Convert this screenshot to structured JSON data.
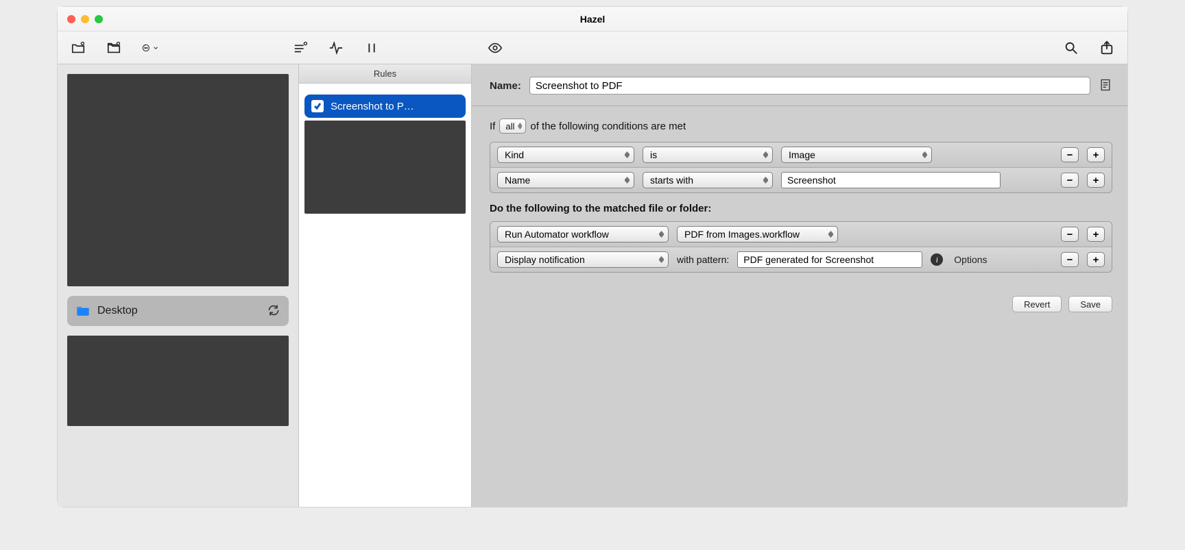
{
  "window": {
    "title": "Hazel"
  },
  "sidebar": {
    "folder_name": "Desktop"
  },
  "rules_panel": {
    "header": "Rules",
    "items": [
      {
        "label": "Screenshot to P…",
        "checked": true
      }
    ]
  },
  "editor": {
    "name_label": "Name:",
    "name_value": "Screenshot to PDF",
    "if_prefix": "If",
    "match_scope": "all",
    "if_suffix": "of the following conditions are met",
    "conditions": [
      {
        "attribute": "Kind",
        "operator": "is",
        "value_select": "Image"
      },
      {
        "attribute": "Name",
        "operator": "starts with",
        "value_text": "Screenshot"
      }
    ],
    "actions_header": "Do the following to the matched file or folder:",
    "actions": [
      {
        "type": "Run Automator workflow",
        "target": "PDF from Images.workflow"
      },
      {
        "type": "Display notification",
        "with_pattern_label": "with pattern:",
        "pattern": "PDF generated for Screenshot",
        "options_label": "Options"
      }
    ],
    "buttons": {
      "revert": "Revert",
      "save": "Save"
    }
  }
}
